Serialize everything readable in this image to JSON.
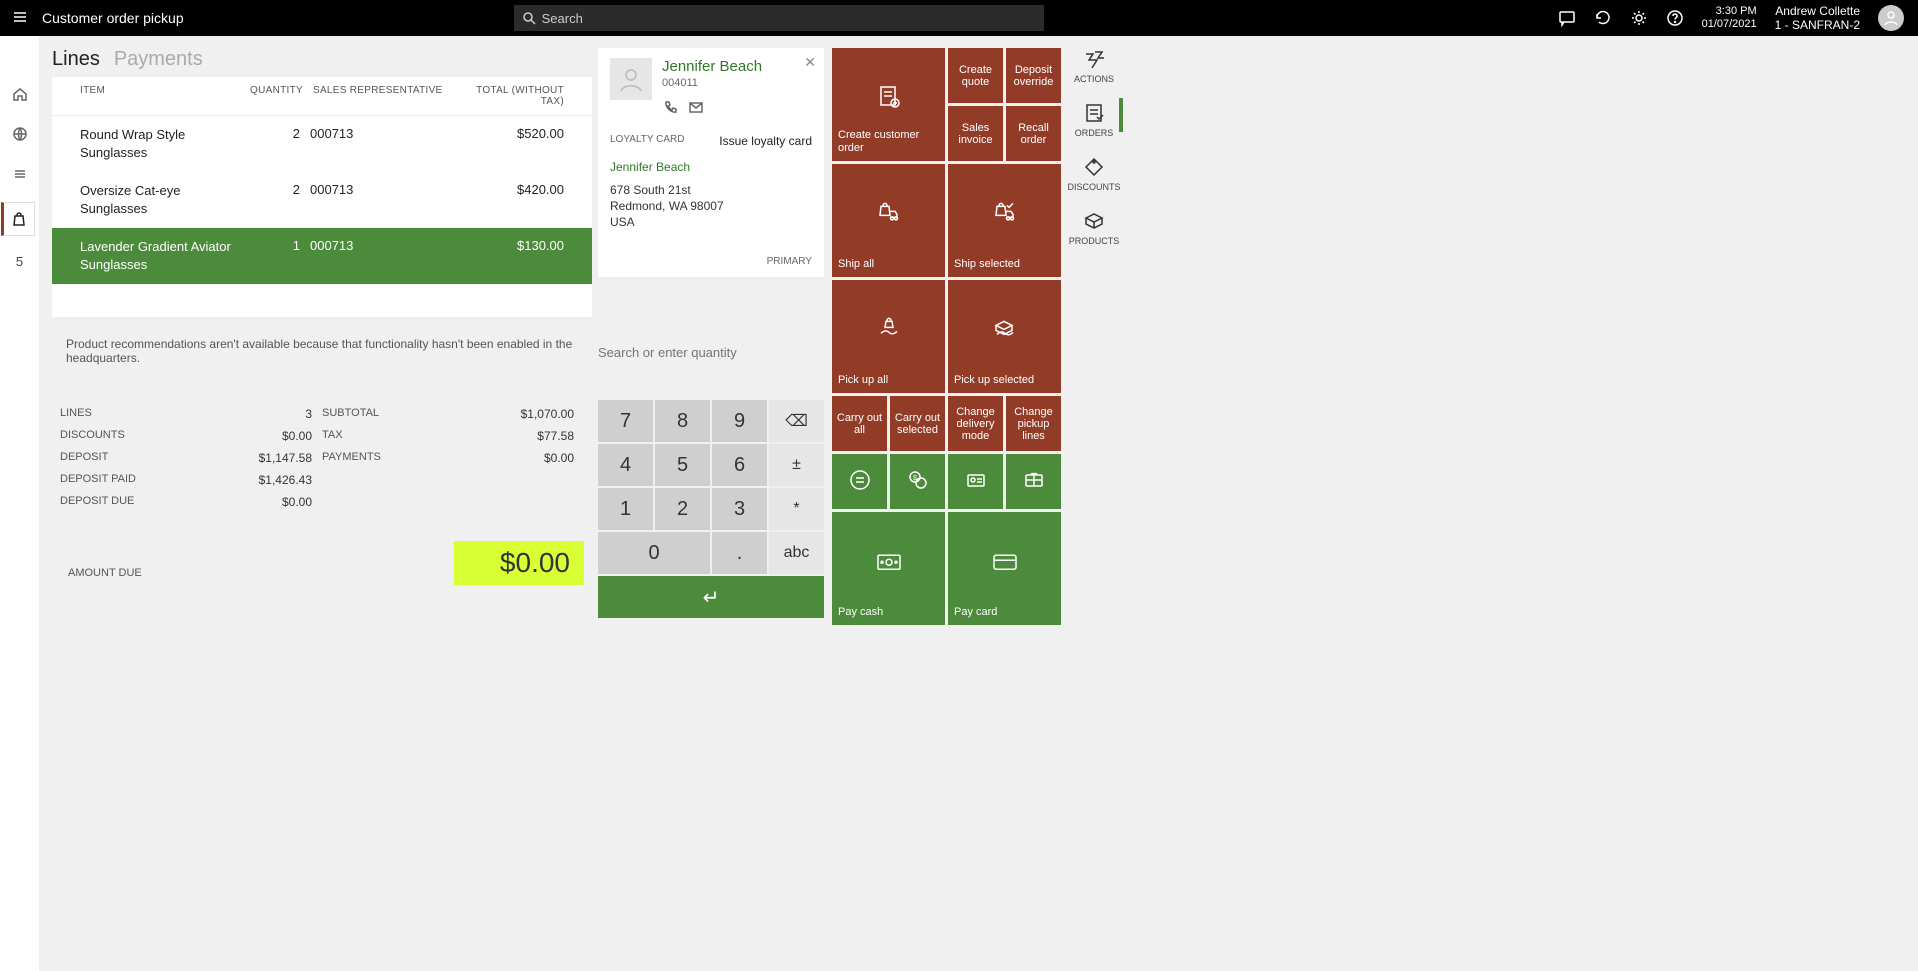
{
  "header": {
    "title": "Customer order pickup",
    "search_placeholder": "Search",
    "time": "3:30 PM",
    "date": "01/07/2021",
    "user_name": "Andrew Collette",
    "user_store": "1 - SANFRAN-2"
  },
  "leftrail": {
    "count": "5"
  },
  "tabs": {
    "lines": "Lines",
    "payments": "Payments"
  },
  "lines_header": {
    "item": "ITEM",
    "qty": "QUANTITY",
    "rep": "SALES REPRESENTATIVE",
    "total": "TOTAL (WITHOUT TAX)"
  },
  "lines": [
    {
      "item": "Round Wrap Style Sunglasses",
      "qty": "2",
      "rep": "000713",
      "total": "$520.00"
    },
    {
      "item": "Oversize Cat-eye Sunglasses",
      "qty": "2",
      "rep": "000713",
      "total": "$420.00"
    },
    {
      "item": "Lavender Gradient Aviator Sunglasses",
      "qty": "1",
      "rep": "000713",
      "total": "$130.00"
    }
  ],
  "recs_note": "Product recommendations aren't available because that functionality hasn't been enabled in the headquarters.",
  "totals": {
    "lines_label": "LINES",
    "lines": "3",
    "discounts_label": "DISCOUNTS",
    "discounts": "$0.00",
    "deposit_label": "DEPOSIT",
    "deposit": "$1,147.58",
    "deposit_paid_label": "DEPOSIT PAID",
    "deposit_paid": "$1,426.43",
    "deposit_due_label": "DEPOSIT DUE",
    "deposit_due": "$0.00",
    "subtotal_label": "SUBTOTAL",
    "subtotal": "$1,070.00",
    "tax_label": "TAX",
    "tax": "$77.58",
    "payments_label": "PAYMENTS",
    "payments": "$0.00",
    "amount_due_label": "AMOUNT DUE",
    "amount_due": "$0.00"
  },
  "customer": {
    "name": "Jennifer Beach",
    "id": "004011",
    "loyalty_label": "LOYALTY CARD",
    "issue_loyalty": "Issue loyalty card",
    "addr_name": "Jennifer Beach",
    "addr1": "678 South 21st",
    "addr2": "Redmond, WA 98007",
    "addr3": "USA",
    "primary": "PRIMARY"
  },
  "qty_search_placeholder": "Search or enter quantity",
  "numpad": {
    "k7": "7",
    "k8": "8",
    "k9": "9",
    "back": "⌫",
    "k4": "4",
    "k5": "5",
    "k6": "6",
    "pm": "±",
    "k1": "1",
    "k2": "2",
    "k3": "3",
    "star": "*",
    "k0": "0",
    "dot": ".",
    "abc": "abc",
    "enter": "↵"
  },
  "tiles": {
    "create_order": "Create customer order",
    "create_quote": "Create quote",
    "deposit_override": "Deposit override",
    "sales_invoice": "Sales invoice",
    "recall_order": "Recall order",
    "ship_all": "Ship all",
    "ship_selected": "Ship selected",
    "pickup_all": "Pick up all",
    "pickup_selected": "Pick up selected",
    "carry_all": "Carry out all",
    "carry_selected": "Carry out selected",
    "change_delivery": "Change delivery mode",
    "change_pickup": "Change pickup lines",
    "pay_cash": "Pay cash",
    "pay_card": "Pay card"
  },
  "side": {
    "actions": "ACTIONS",
    "orders": "ORDERS",
    "discounts": "DISCOUNTS",
    "products": "PRODUCTS"
  }
}
